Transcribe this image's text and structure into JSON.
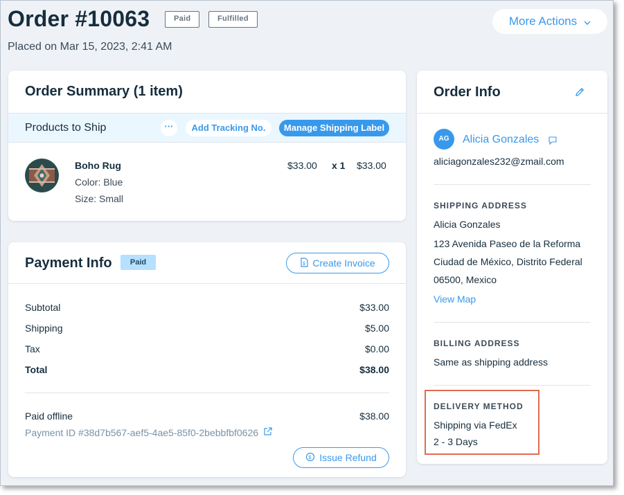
{
  "header": {
    "title": "Order #10063",
    "tags": [
      "Paid",
      "Fulfilled"
    ],
    "placed": "Placed on Mar 15, 2023, 2:41 AM",
    "more_actions": "More Actions"
  },
  "order_summary": {
    "title": "Order Summary (1 item)",
    "products_to_ship": "Products to Ship",
    "dots": "···",
    "add_tracking": "Add Tracking No.",
    "manage_label": "Manage Shipping Label",
    "product": {
      "name": "Boho Rug",
      "color": "Color: Blue",
      "size": "Size: Small",
      "price": "$33.00",
      "qty": "x 1",
      "total": "$33.00"
    }
  },
  "payment": {
    "title": "Payment Info",
    "badge": "Paid",
    "create_invoice": "Create Invoice",
    "rows": [
      {
        "label": "Subtotal",
        "value": "$33.00"
      },
      {
        "label": "Shipping",
        "value": "$5.00"
      },
      {
        "label": "Tax",
        "value": "$0.00"
      },
      {
        "label": "Total",
        "value": "$38.00"
      }
    ],
    "paid_offline": "Paid offline",
    "paid_amount": "$38.00",
    "payment_id": "Payment ID #38d7b567-aef5-4ae5-85f0-2bebbfbf0626",
    "issue_refund": "Issue Refund"
  },
  "order_info": {
    "title": "Order Info",
    "customer": {
      "initials": "AG",
      "name": "Alicia Gonzales",
      "email": "aliciagonzales232@zmail.com"
    },
    "shipping_address": {
      "heading": "SHIPPING ADDRESS",
      "lines": [
        "Alicia Gonzales",
        "123 Avenida Paseo de la Reforma",
        "Ciudad de México, Distrito Federal",
        "06500, Mexico"
      ],
      "view_map": "View Map"
    },
    "billing_address": {
      "heading": "BILLING ADDRESS",
      "text": "Same as shipping address"
    },
    "delivery_method": {
      "heading": "DELIVERY METHOD",
      "method": "Shipping via FedEx",
      "days": "2 - 3 Days"
    }
  },
  "colors": {
    "accent": "#3899ec",
    "background": "#eef2f7",
    "highlight": "#e06c4f"
  }
}
